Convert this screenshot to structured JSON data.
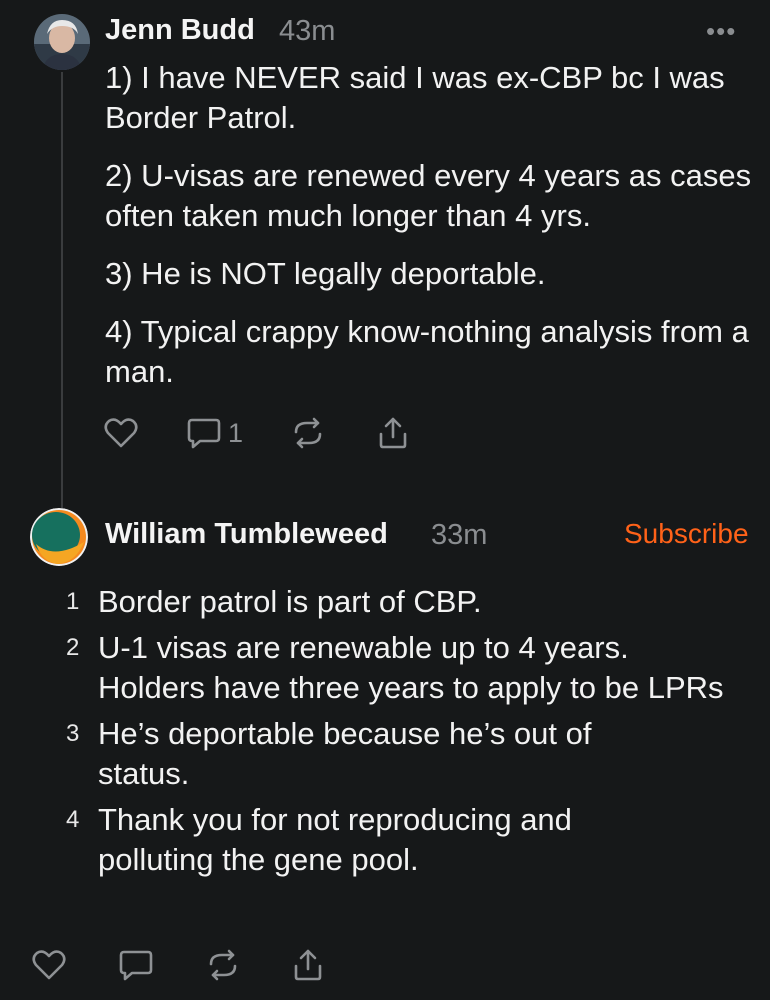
{
  "post1": {
    "author": "Jenn Budd",
    "time": "43m",
    "more": "•••",
    "paragraphs": [
      "1) I have NEVER said I was ex-CBP bc I was Border Patrol.",
      "2) U-visas are renewed every 4 years as cases often taken much longer than 4 yrs.",
      "3) He is NOT legally deportable.",
      "4) Typical crappy know-nothing analysis from a man."
    ],
    "comment_count": "1"
  },
  "post2": {
    "author": "William Tumbleweed",
    "time": "33m",
    "subscribe": "Subscribe",
    "items": [
      {
        "num": "1",
        "text": "Border patrol is part of CBP."
      },
      {
        "num": "2",
        "text": "U-1 visas are renewable up to 4 years. Holders have three years to apply to be LPRs"
      },
      {
        "num": "3",
        "text": "He’s deportable because he’s out of status."
      },
      {
        "num": "4",
        "text": "Thank you for not reproducing and polluting the gene pool."
      }
    ]
  },
  "colors": {
    "background": "#161819",
    "accent": "#ff6219",
    "muted": "#8a8d90"
  },
  "icons": [
    "heart-icon",
    "comment-icon",
    "restack-icon",
    "share-icon"
  ]
}
